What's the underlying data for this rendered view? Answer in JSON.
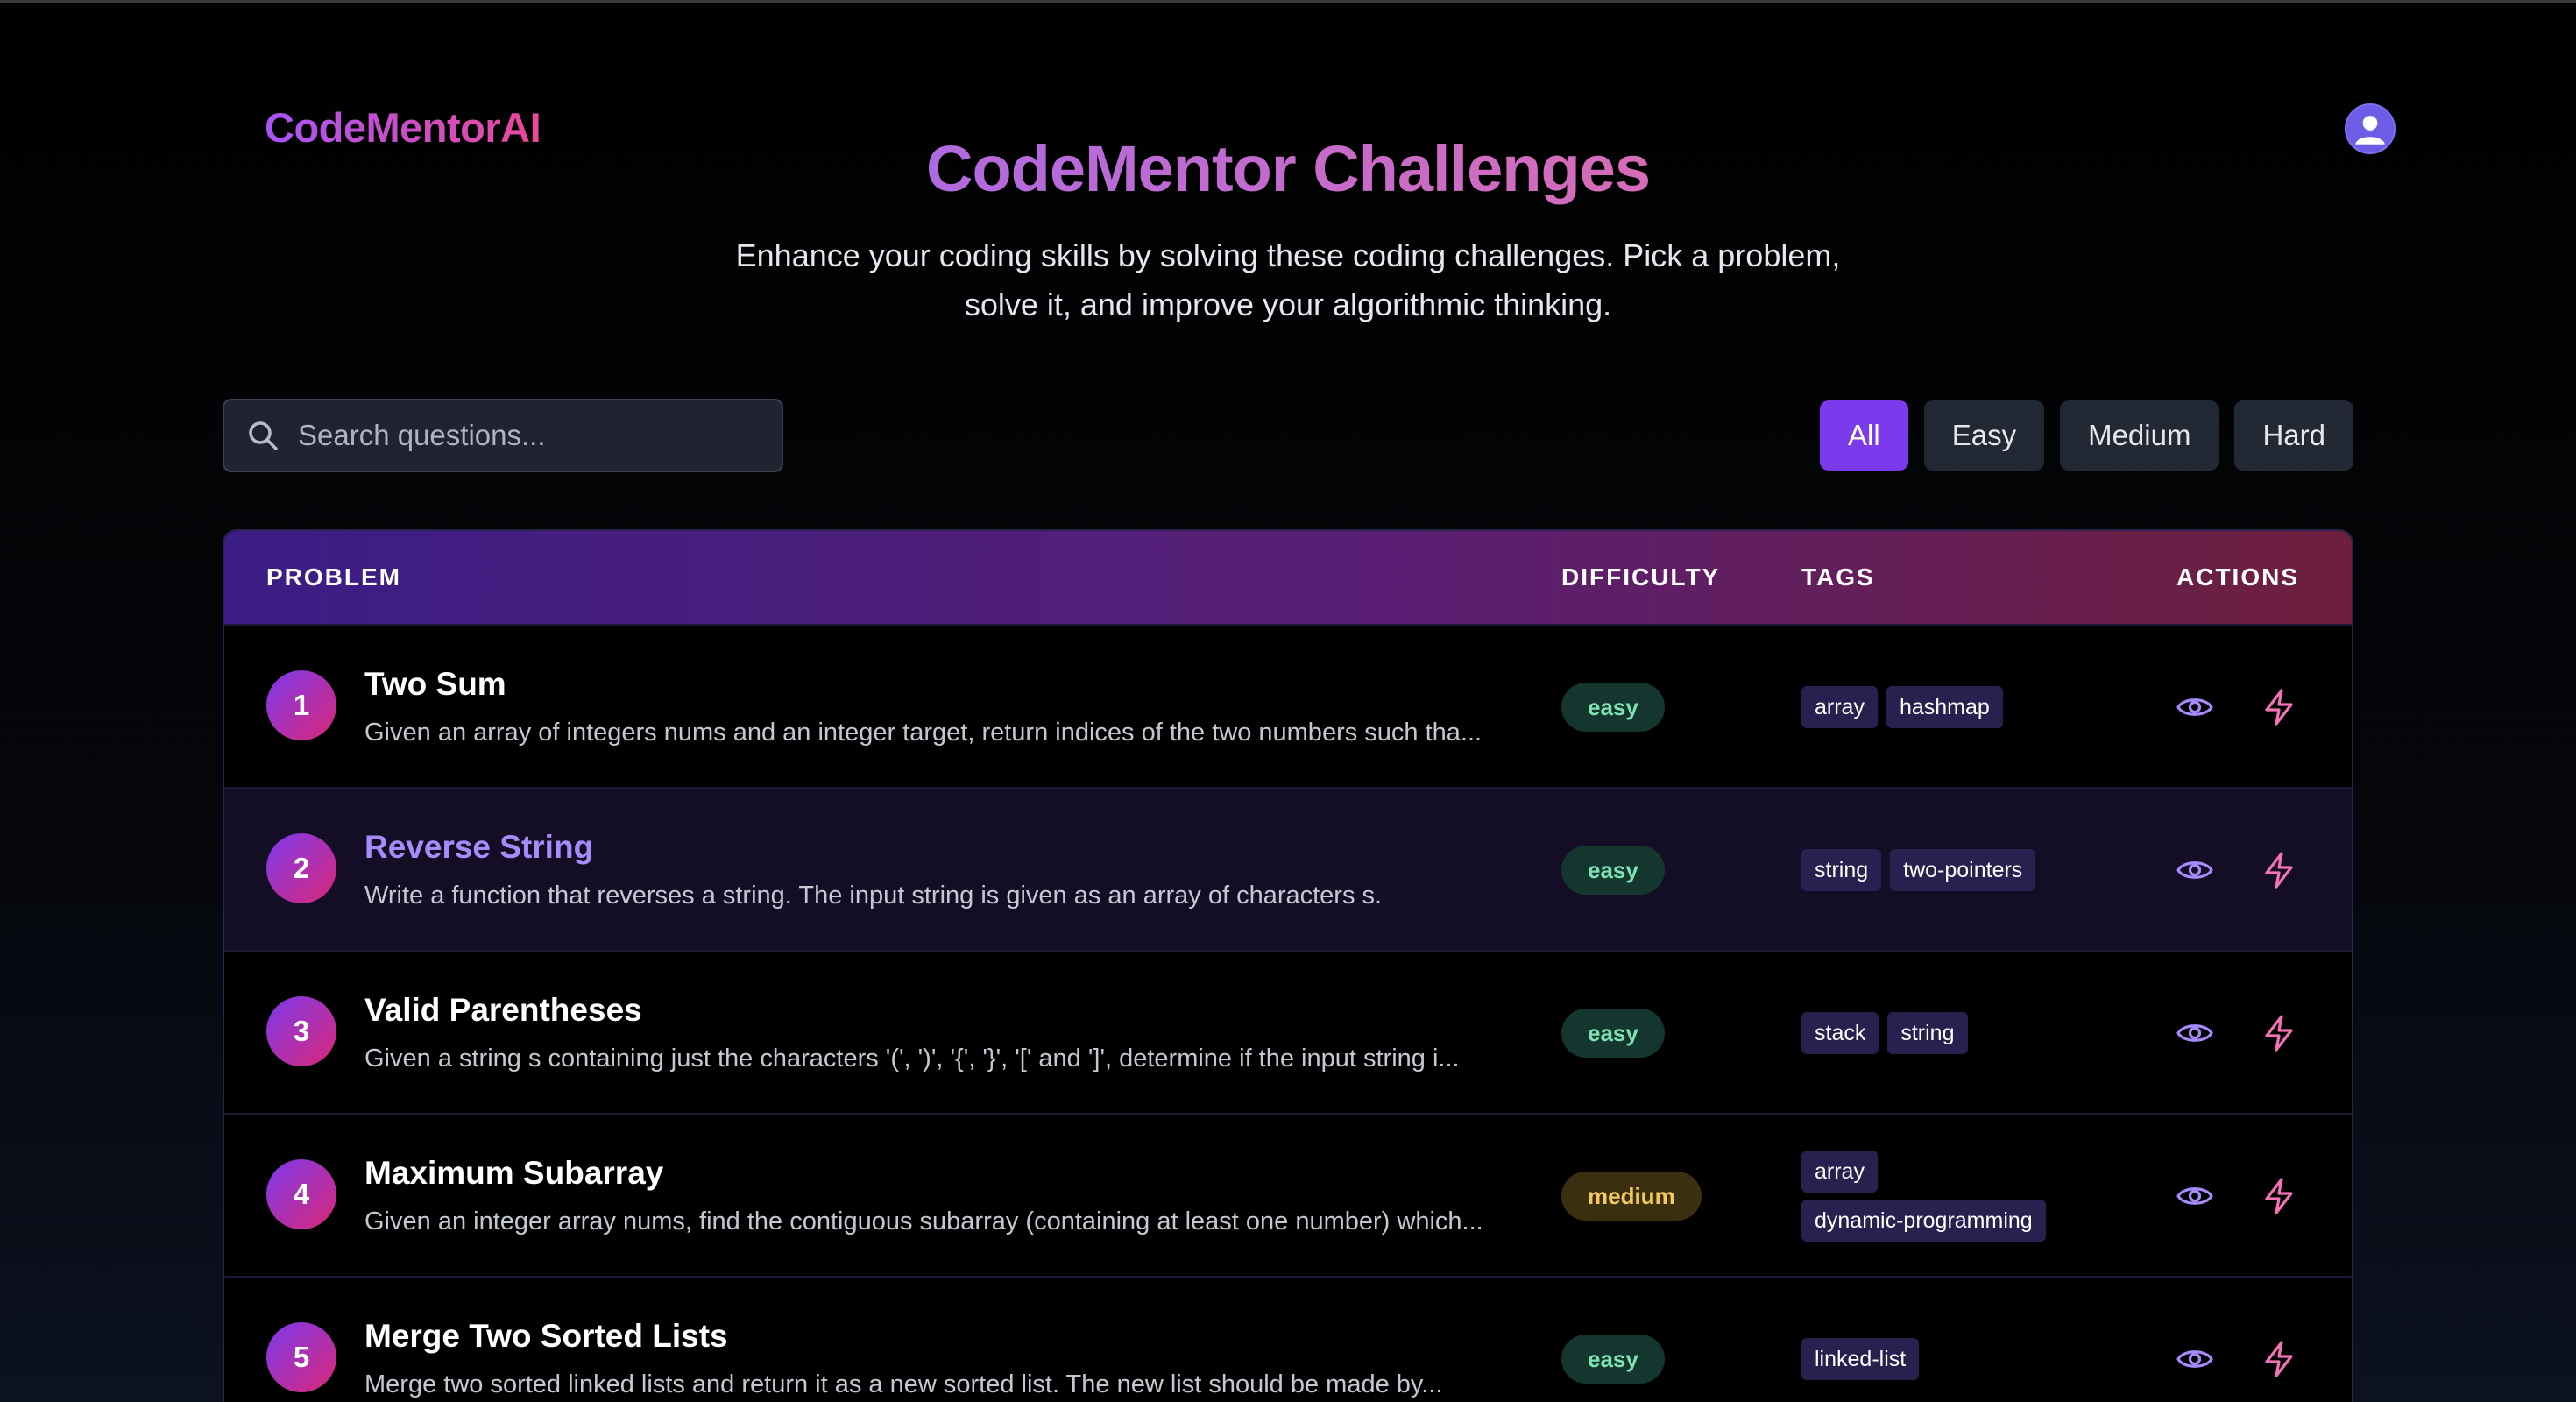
{
  "brand": "CodeMentorAI",
  "hero": {
    "title": "CodeMentor Challenges",
    "subtitle_line1": "Enhance your coding skills by solving these coding challenges. Pick a problem,",
    "subtitle_line2": "solve it, and improve your algorithmic thinking."
  },
  "search": {
    "placeholder": "Search questions..."
  },
  "filters": [
    "All",
    "Easy",
    "Medium",
    "Hard"
  ],
  "active_filter": "All",
  "table": {
    "headers": {
      "problem": "PROBLEM",
      "difficulty": "DIFFICULTY",
      "tags": "TAGS",
      "actions": "ACTIONS"
    },
    "rows": [
      {
        "num": "1",
        "title": "Two Sum",
        "desc": "Given an array of integers nums and an integer target, return indices of the two numbers such tha...",
        "difficulty": "easy",
        "tags": [
          "array",
          "hashmap"
        ]
      },
      {
        "num": "2",
        "title": "Reverse String",
        "desc": "Write a function that reverses a string. The input string is given as an array of characters s.",
        "difficulty": "easy",
        "tags": [
          "string",
          "two-pointers"
        ]
      },
      {
        "num": "3",
        "title": "Valid Parentheses",
        "desc": "Given a string s containing just the characters '(', ')', '{', '}', '[' and ']', determine if the input string i...",
        "difficulty": "easy",
        "tags": [
          "stack",
          "string"
        ]
      },
      {
        "num": "4",
        "title": "Maximum Subarray",
        "desc": "Given an integer array nums, find the contiguous subarray (containing at least one number) which...",
        "difficulty": "medium",
        "tags": [
          "array",
          "dynamic-programming"
        ]
      },
      {
        "num": "5",
        "title": "Merge Two Sorted Lists",
        "desc": "Merge two sorted linked lists and return it as a new sorted list. The new list should be made by...",
        "difficulty": "easy",
        "tags": [
          "linked-list"
        ]
      }
    ]
  },
  "icons": {
    "search": "search-icon",
    "view": "eye-icon",
    "solve": "bolt-icon",
    "avatar": "user-icon"
  },
  "colors": {
    "accent": "#7c3aed",
    "pink": "#ec4899",
    "easy": "#7ee2b3",
    "medium": "#f4c95d"
  }
}
